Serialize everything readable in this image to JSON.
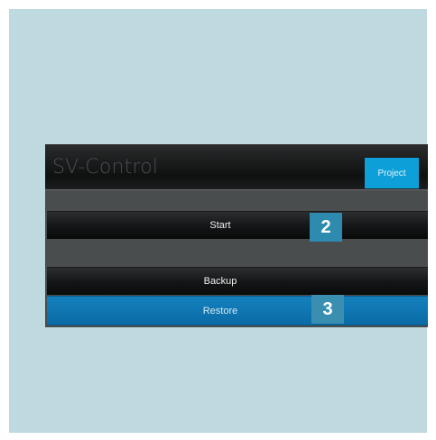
{
  "app": {
    "title": "SV-Control"
  },
  "tabs": {
    "project": "Project"
  },
  "buttons": {
    "start": "Start",
    "backup": "Backup",
    "restore": "Restore"
  },
  "callouts": {
    "start": "2",
    "restore": "3"
  },
  "colors": {
    "frame_background": "#bed9df",
    "tab_accent": "#0d9fd8",
    "restore_button": "#0a6ba6",
    "callout": "#2e8aae"
  }
}
